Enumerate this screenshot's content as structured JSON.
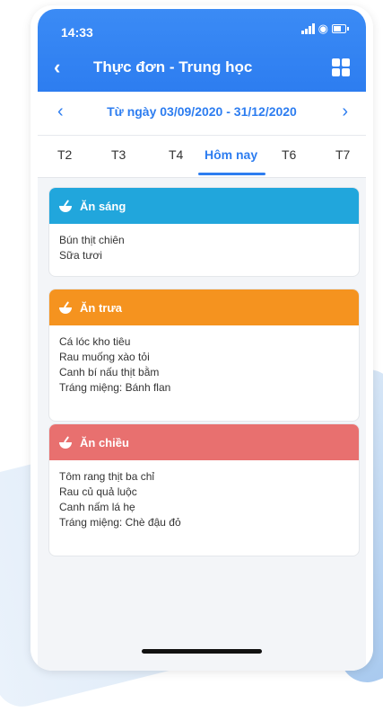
{
  "status": {
    "time": "14:33"
  },
  "app": {
    "title": "Thực đơn - Trung học",
    "back_icon": "chevron-left-icon",
    "menu_icon": "grid-icon"
  },
  "date_range": {
    "label": "Từ ngày 03/09/2020 - 31/12/2020",
    "prev_icon": "chevron-left-icon",
    "next_icon": "chevron-right-icon"
  },
  "tabs": [
    {
      "label": "T2",
      "active": false
    },
    {
      "label": "T3",
      "active": false
    },
    {
      "label": "T4",
      "active": false
    },
    {
      "label": "Hôm nay",
      "active": true
    },
    {
      "label": "T6",
      "active": false
    },
    {
      "label": "T7",
      "active": false
    }
  ],
  "meals": [
    {
      "title": "Ăn sáng",
      "color": "#21a6dc",
      "icon": "bowl-icon",
      "items": [
        "Bún thịt chiên",
        "Sữa tươi"
      ]
    },
    {
      "title": "Ăn trưa",
      "color": "#f5931f",
      "icon": "bowl-icon",
      "items": [
        "Cá lóc kho tiêu",
        "Rau muống xào tỏi",
        "Canh bí nấu thịt bằm",
        "Tráng miệng: Bánh flan"
      ]
    },
    {
      "title": "Ăn chiều",
      "color": "#e8706f",
      "icon": "bowl-icon",
      "items": [
        "Tôm rang thịt ba chỉ",
        "Rau củ quả luộc",
        "Canh nấm lá hẹ",
        "Tráng miệng: Chè đậu đỏ"
      ]
    }
  ]
}
